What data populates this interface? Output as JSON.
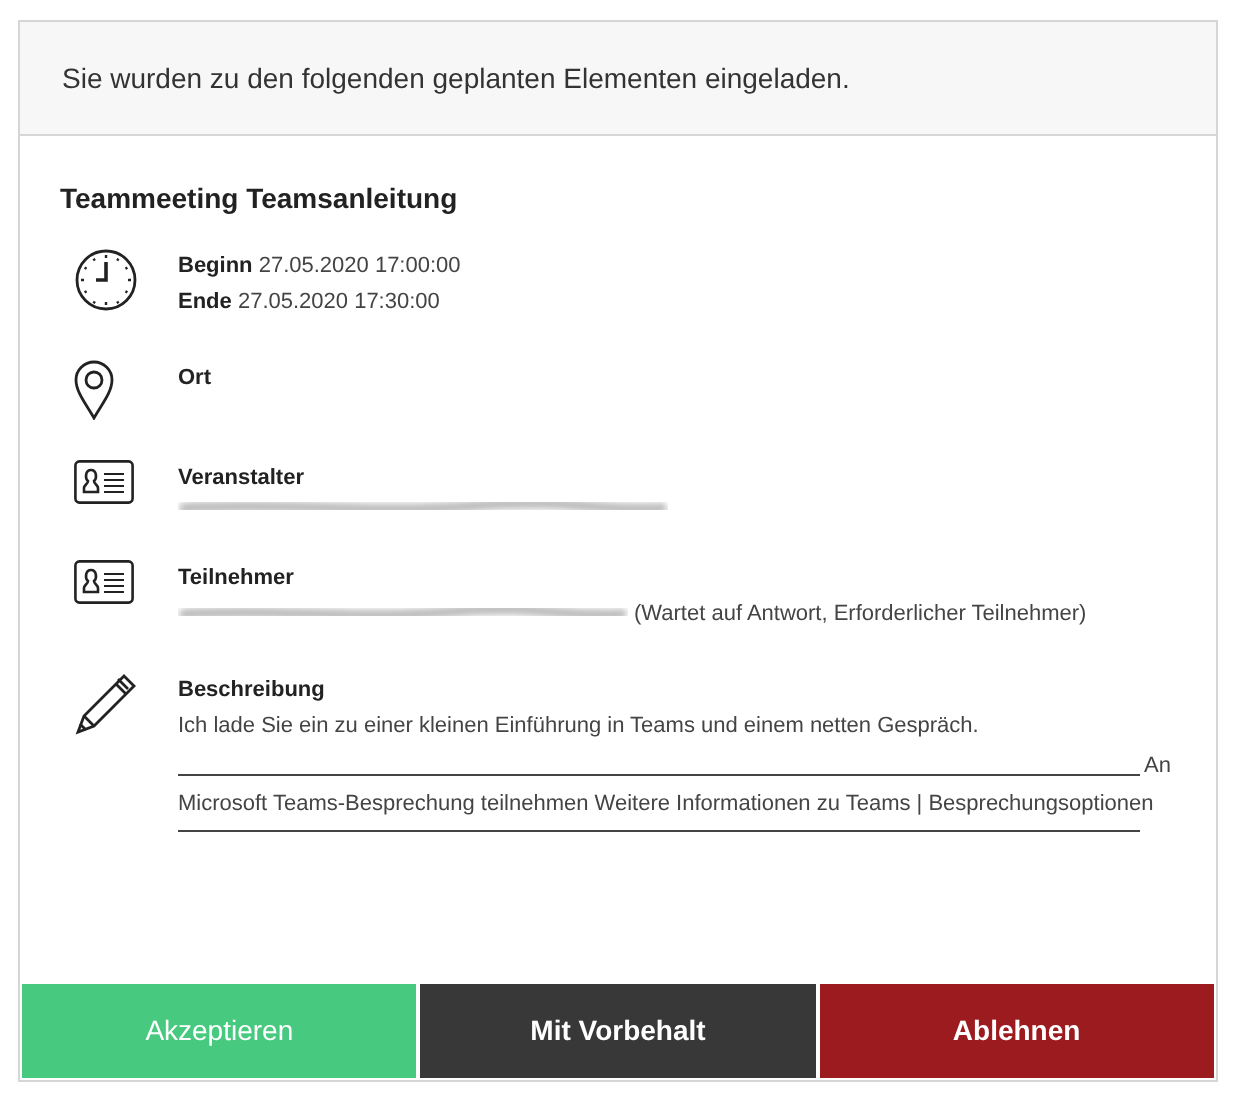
{
  "header": {
    "text": "Sie wurden zu den folgenden geplanten Elementen eingeladen."
  },
  "title": "Teammeeting Teamsanleitung",
  "sections": [
    {
      "kind": "time",
      "lines": [
        {
          "label": "Beginn",
          "value": "27.05.2020 17:00:00"
        },
        {
          "label": "Ende",
          "value": "27.05.2020 17:30:00"
        }
      ]
    },
    {
      "kind": "location",
      "label": "Ort"
    },
    {
      "kind": "person",
      "label": "Veranstalter",
      "redacted": true
    },
    {
      "kind": "person",
      "label": "Teilnehmer",
      "redacted": true,
      "note": "(Wartet auf Antwort, Erforderlicher Teilnehmer)"
    },
    {
      "kind": "description",
      "label": "Beschreibung",
      "text": "Ich lade Sie ein zu einer kleinen Einführung in Teams und einem netten Gespräch.",
      "after_rule": "An",
      "link_line": "Microsoft Teams-Besprechung teilnehmen Weitere Informationen zu Teams | Besprechungsoptionen"
    }
  ],
  "buttons": [
    {
      "label": "Akzeptieren",
      "kind": "accept"
    },
    {
      "label": "Mit Vorbehalt",
      "kind": "tentative"
    },
    {
      "label": "Ablehnen",
      "kind": "decline"
    }
  ]
}
